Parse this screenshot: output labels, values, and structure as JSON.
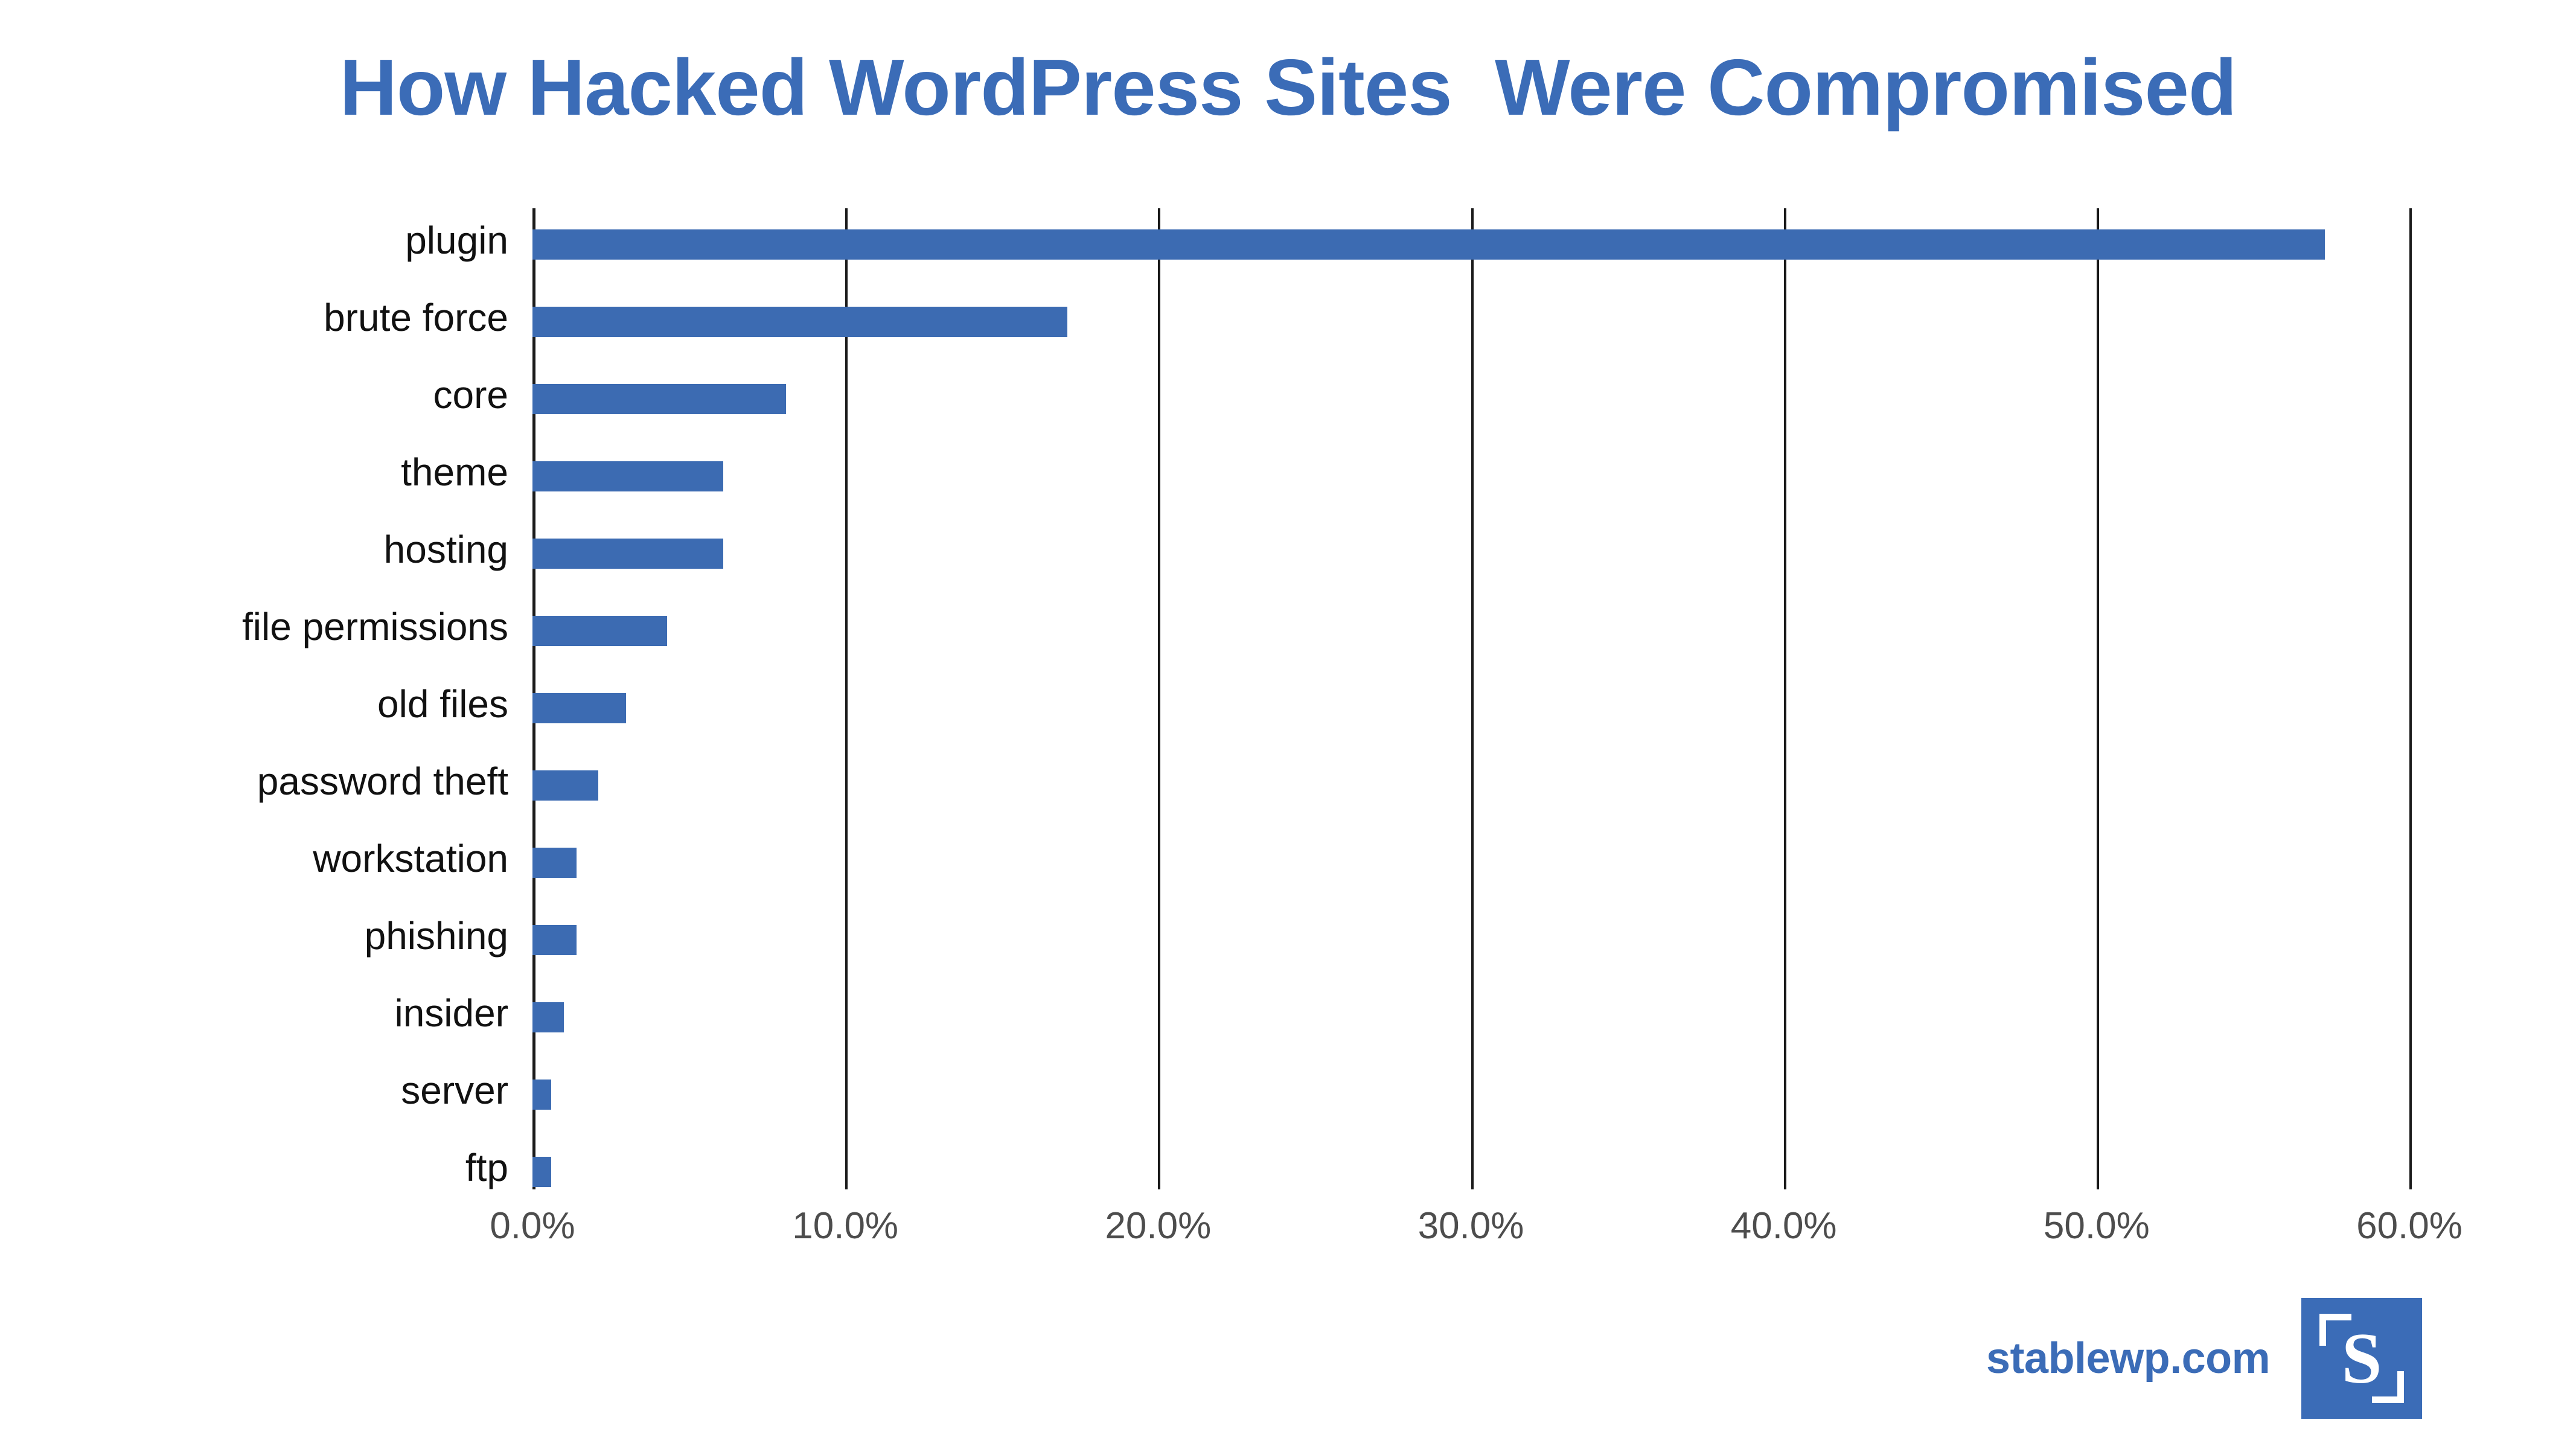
{
  "title": "How Hacked WordPress Sites  Were Compromised",
  "colors": {
    "title": "#3B6CB7",
    "bar": "#3C6BB2",
    "axis": "#1a1a1a",
    "xtick_text": "#4d4d4d",
    "ytick_text": "#111111",
    "brand": "#3B6CB7",
    "background": "#ffffff"
  },
  "brand": {
    "site": "stablewp.com",
    "logo_letter": "S"
  },
  "chart_data": {
    "type": "bar",
    "orientation": "horizontal",
    "title": "How Hacked WordPress Sites  Were Compromised",
    "xlabel": "",
    "ylabel": "",
    "xlim": [
      0,
      60
    ],
    "xticks": [
      0,
      10,
      20,
      30,
      40,
      50,
      60
    ],
    "xtick_labels": [
      "0.0%",
      "10.0%",
      "20.0%",
      "30.0%",
      "40.0%",
      "50.0%",
      "60.0%"
    ],
    "grid": "vertical",
    "legend": "none",
    "value_unit": "%",
    "categories": [
      "plugin",
      "brute force",
      "core",
      "theme",
      "hosting",
      "file permissions",
      "old files",
      "password theft",
      "workstation",
      "phishing",
      "insider",
      "server",
      "ftp"
    ],
    "values": [
      57.3,
      17.1,
      8.1,
      6.1,
      6.1,
      4.3,
      3.0,
      2.1,
      1.4,
      1.4,
      1.0,
      0.6,
      0.6
    ]
  }
}
